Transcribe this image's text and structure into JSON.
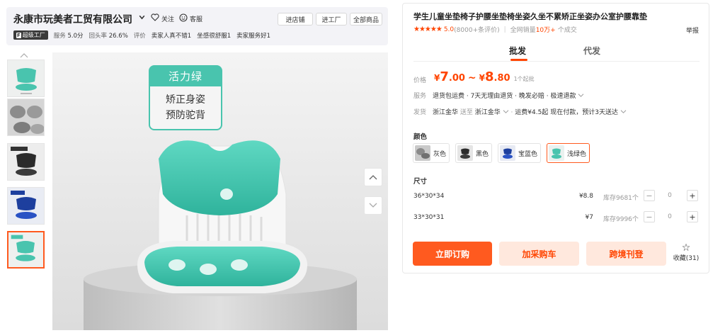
{
  "store": {
    "name": "永康市玩美者工贸有限公司",
    "follow_label": "关注",
    "service_label": "客服",
    "buttons": [
      "进店铺",
      "进工厂",
      "全部商品"
    ],
    "badge": "超级工厂",
    "service_score_label": "服务",
    "service_score": "5.0分",
    "repurchase_label": "回头率",
    "repurchase": "26.6%",
    "review_label": "评价",
    "review_tags": [
      "卖家人真不错1",
      "坐感很舒服1",
      "卖家服务好1"
    ]
  },
  "gallery": {
    "tag_title": "活力绿",
    "tag_lines": [
      "矫正身姿",
      "预防驼背"
    ],
    "selected_index": 4
  },
  "product": {
    "title": "学生儿童坐垫椅子护腰坐垫椅坐姿久坐不累矫正坐姿办公室护腰靠垫",
    "stars": "★★★★★",
    "score": "5.0",
    "reviews": "(8000+条评价)",
    "sales_prefix": "全网销量",
    "sales_value": "10万+",
    "sales_suffix": "个成交",
    "report": "举报",
    "tabs": [
      "批发",
      "代发"
    ],
    "price_label": "价格",
    "price_low_int": "7",
    "price_low_dec": ".00",
    "price_high_int": "8",
    "price_high_dec": ".80",
    "currency": "¥",
    "moq": "1个起批",
    "service_label": "服务",
    "service_text": "退货包运费 · 7天无理由退货 · 晚发必赔 · 极速退款",
    "ship_label": "发货",
    "ship_from": "浙江金华",
    "ship_to_word": "送至",
    "ship_to": "浙江金华",
    "ship_fee": "运费¥4.5起",
    "ship_time": "现在付款，预计3天送达",
    "color_title": "颜色",
    "colors": [
      {
        "name": "灰色",
        "swatch": "#8a8a8a"
      },
      {
        "name": "黑色",
        "swatch": "#2b2b2b"
      },
      {
        "name": "宝蓝色",
        "swatch": "#1d3f9e"
      },
      {
        "name": "浅绿色",
        "swatch": "#49c4ae"
      }
    ],
    "selected_color": "浅绿色",
    "size_title": "尺寸",
    "sizes": [
      {
        "name": "36*30*34",
        "price": "¥8.8",
        "stock": "库存9681个",
        "qty": "0"
      },
      {
        "name": "33*30*31",
        "price": "¥7",
        "stock": "库存9996个",
        "qty": "0"
      }
    ],
    "actions": {
      "order": "立即订购",
      "cart": "加采购车",
      "crossborder": "跨境刊登",
      "favorite": "收藏(31)"
    }
  }
}
